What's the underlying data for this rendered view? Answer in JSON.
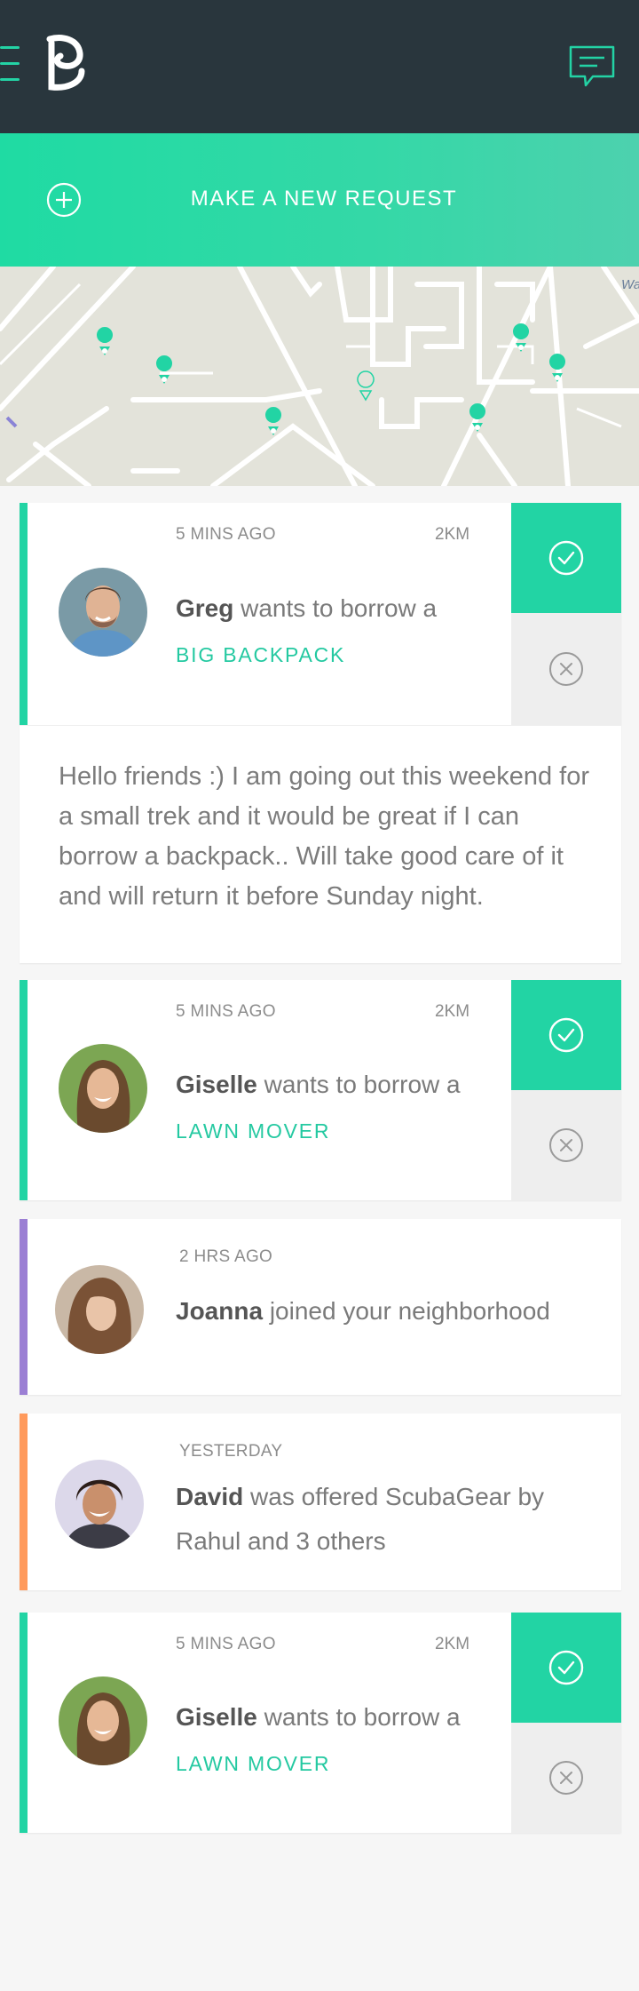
{
  "header": {
    "menu_icon": "menu-icon",
    "logo_icon": "logo-icon",
    "chat_icon": "chat-icon",
    "bg_color": "#29363d"
  },
  "request_bar": {
    "label": "MAKE A NEW REQUEST",
    "icon": "plus-circle-icon"
  },
  "map": {
    "label": "Wa",
    "pin_color": "#22d4a4"
  },
  "feed": {
    "cards": [
      {
        "time": "5 MINS AGO",
        "distance": "2KM",
        "name": "Greg",
        "action": "wants to borrow a",
        "item": "BIG BACKPACK",
        "message": [
          "Hello friends :) I am going out this weekend for",
          "a small trek and it would be great if I can",
          "borrow a backpack.. Will take good care of it",
          "and will return it before Sunday night."
        ],
        "stripe_color": "#22d4a4"
      },
      {
        "time": "5 MINS AGO",
        "distance": "2KM",
        "name": "Giselle",
        "action": "wants to borrow a",
        "item": "LAWN MOVER",
        "stripe_color": "#22d4a4"
      },
      {
        "time": "2 HRS AGO",
        "name": "Joanna",
        "action": "joined your neighborhood",
        "stripe_color": "#9b7fd4"
      },
      {
        "time": "YESTERDAY",
        "name": "David",
        "action": "was offered ScubaGear by",
        "action2": "Rahul and 3 others",
        "stripe_color": "#ff9a5c"
      },
      {
        "time": "5 MINS AGO",
        "distance": "2KM",
        "name": "Giselle",
        "action": "wants to borrow a",
        "item": "LAWN MOVER",
        "stripe_color": "#22d4a4"
      }
    ]
  }
}
